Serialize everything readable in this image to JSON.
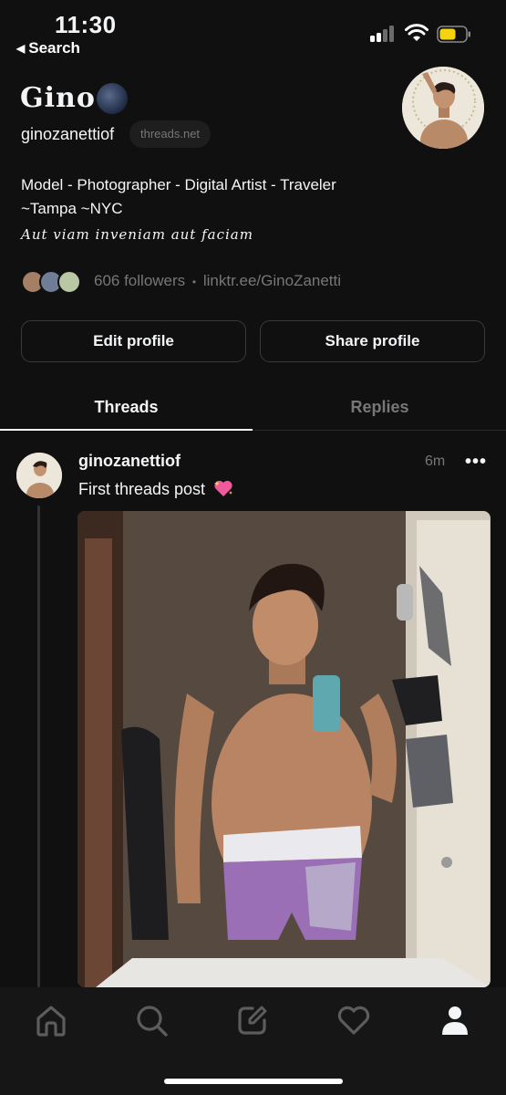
{
  "status_bar": {
    "time": "11:30",
    "back_label": "Search"
  },
  "profile": {
    "name": "Gino",
    "handle": "ginozanettiof",
    "domain_badge": "threads.net",
    "bio_lines": [
      "Model - Photographer - Digital Artist - Traveler",
      "~Tampa ~NYC"
    ],
    "motto": "Aut viam inveniam aut faciam",
    "followers_text": "606 followers",
    "separator": "•",
    "link": "linktr.ee/GinoZanetti"
  },
  "actions": {
    "edit_label": "Edit profile",
    "share_label": "Share profile"
  },
  "tabs": [
    {
      "label": "Threads",
      "active": true
    },
    {
      "label": "Replies",
      "active": false
    }
  ],
  "post": {
    "username": "ginozanettiof",
    "time": "6m",
    "more_label": "•••",
    "text": "First threads post",
    "emoji": "sparkling-heart-icon",
    "image": "mirror-selfie-photo"
  },
  "bottom_nav": [
    {
      "name": "home-icon"
    },
    {
      "name": "search-icon"
    },
    {
      "name": "compose-icon"
    },
    {
      "name": "activity-heart-icon"
    },
    {
      "name": "profile-icon",
      "active": true
    }
  ],
  "colors": {
    "background": "#101010",
    "text": "#f3f5f7",
    "muted": "#777777",
    "border": "#3a3a3a",
    "battery": "#f5d40f"
  }
}
